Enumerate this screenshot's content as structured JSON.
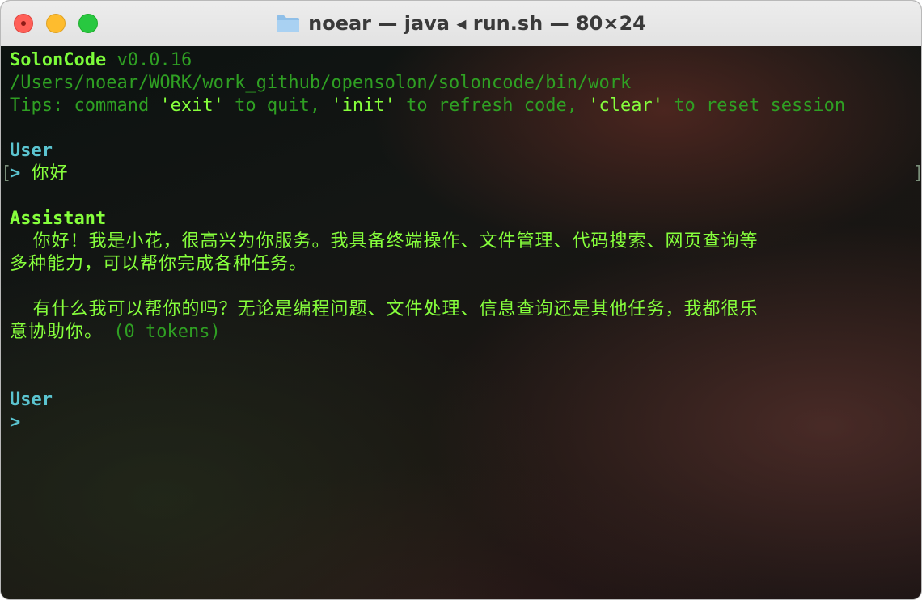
{
  "window": {
    "title": "noear — java ◂ run.sh — 80×24",
    "folder_icon": "folder-icon"
  },
  "terminal": {
    "app_name": "SolonCode",
    "version": "v0.0.16",
    "path": "/Users/noear/WORK/work_github/opensolon/soloncode/bin/work",
    "tips": {
      "prefix": "Tips: command ",
      "cmd1": "'exit'",
      "mid1": " to quit, ",
      "cmd2": "'init'",
      "mid2": " to refresh code, ",
      "cmd3": "'clear'",
      "suffix": " to reset session"
    },
    "conversation": [
      {
        "role": "User",
        "prompt": ">",
        "text": "你好"
      },
      {
        "role": "Assistant",
        "lines": [
          "  你好！我是小花，很高兴为你服务。我具备终端操作、文件管理、代码搜索、网页查询等",
          "多种能力，可以帮你完成各种任务。",
          "",
          "  有什么我可以帮你的吗？无论是编程问题、文件处理、信息查询还是其他任务，我都很乐",
          "意协助你。"
        ],
        "tokens": " (0 tokens)"
      },
      {
        "role": "User",
        "prompt": ">"
      }
    ],
    "input_bracket_left": "[",
    "input_bracket_right": "]"
  }
}
